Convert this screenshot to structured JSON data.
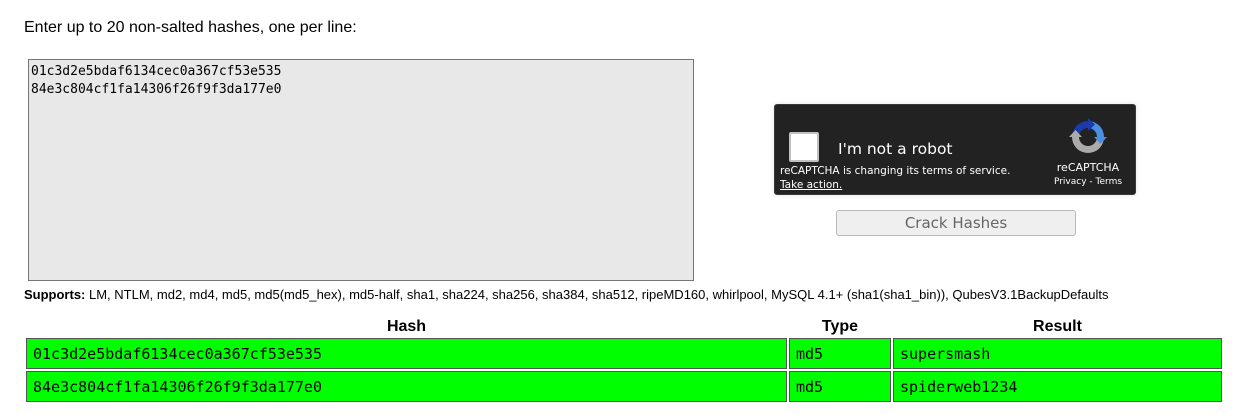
{
  "prompt": "Enter up to 20 non-salted hashes, one per line:",
  "hash_input": {
    "value": "01c3d2e5bdaf6134cec0a367cf53e535\n84e3c804cf1fa14306f26f9f3da177e0"
  },
  "captcha": {
    "checkbox_label": "I'm not a robot",
    "terms_notice": "reCAPTCHA is changing its terms of service.",
    "action_link": "Take action.",
    "brand": "reCAPTCHA",
    "privacy_link": "Privacy",
    "separator": " - ",
    "terms_link": "Terms",
    "logo_icon": "recaptcha-logo-icon",
    "colors": {
      "background": "#222222",
      "logo_blue": "#1c3aa9",
      "logo_light": "#4a90e2",
      "logo_gray": "#ababab"
    }
  },
  "crack_button": {
    "label": "Crack Hashes"
  },
  "supports": {
    "label": "Supports:",
    "text": " LM, NTLM, md2, md4, md5, md5(md5_hex), md5-half, sha1, sha224, sha256, sha384, sha512, ripeMD160, whirlpool, MySQL 4.1+ (sha1(sha1_bin)), QubesV3.1BackupDefaults"
  },
  "results": {
    "headers": {
      "hash": "Hash",
      "type": "Type",
      "result": "Result"
    },
    "rows": [
      {
        "hash": "01c3d2e5bdaf6134cec0a367cf53e535",
        "type": "md5",
        "result": "supersmash"
      },
      {
        "hash": "84e3c804cf1fa14306f26f9f3da177e0",
        "type": "md5",
        "result": "spiderweb1234"
      }
    ],
    "row_color": "#00ff00"
  }
}
